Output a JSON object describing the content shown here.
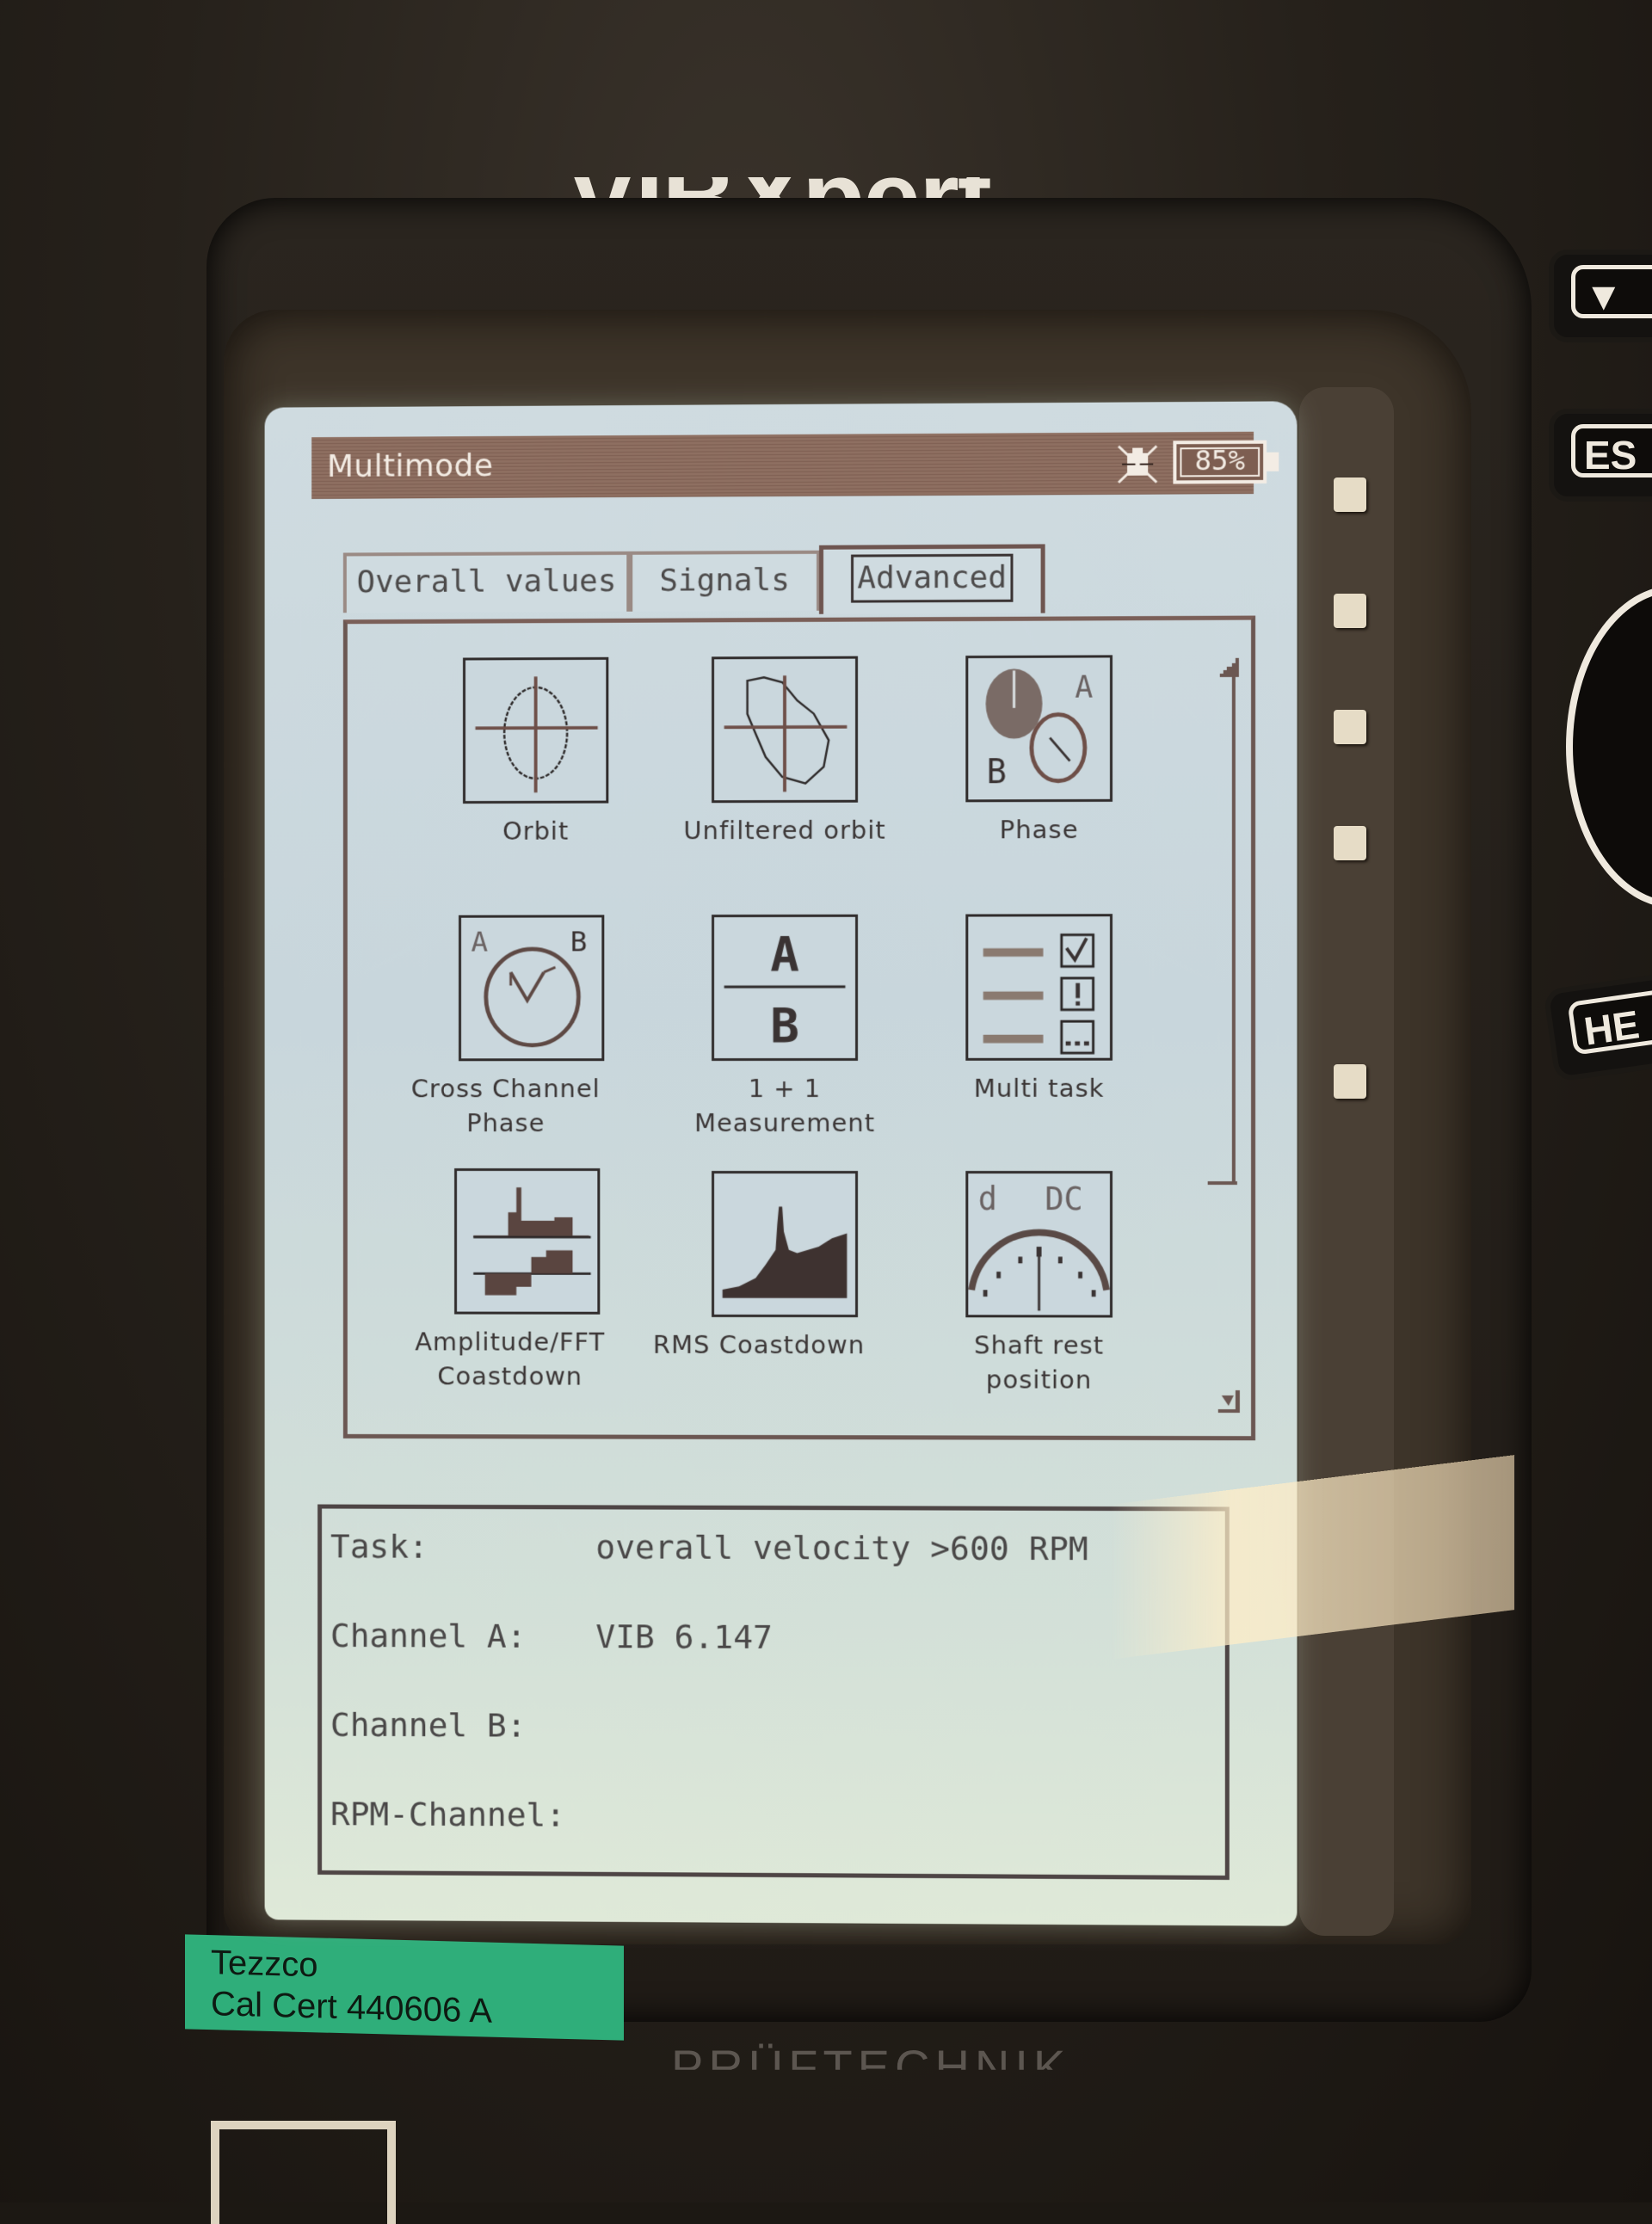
{
  "device": {
    "brand_top": "VIBXpert",
    "brand_bottom": "PRÜFTECHNIK",
    "asset_label": [
      "Tezzco",
      "Cal Cert 440606 A"
    ],
    "hardware_buttons": [
      {
        "name": "down-arrow-button",
        "label": "▼"
      },
      {
        "name": "esc-button",
        "label": "ES"
      },
      {
        "name": "help-button",
        "label": "HE"
      }
    ],
    "soft_key_count": 5
  },
  "titlebar": {
    "title": "Multimode",
    "sensor_icon": "sensor-disconnected-icon",
    "battery_percent": "85%"
  },
  "tabs": [
    {
      "label": "Overall values",
      "active": false
    },
    {
      "label": "Signals",
      "active": false
    },
    {
      "label": "Advanced",
      "active": true
    }
  ],
  "modes": [
    {
      "label": "Orbit",
      "icon": "orbit-icon"
    },
    {
      "label": "Unfiltered orbit",
      "icon": "unfiltered-orbit-icon"
    },
    {
      "label": "Phase",
      "icon": "phase-icon"
    },
    {
      "label": "Cross Channel\nPhase",
      "icon": "cross-channel-phase-icon"
    },
    {
      "label": "1 + 1\nMeasurement",
      "icon": "one-plus-one-measurement-icon"
    },
    {
      "label": "Multi task",
      "icon": "multi-task-icon"
    },
    {
      "label": "Amplitude/FFT\nCoastdown",
      "icon": "amplitude-fft-coastdown-icon"
    },
    {
      "label": "RMS Coastdown",
      "icon": "rms-coastdown-icon"
    },
    {
      "label": "Shaft rest\nposition",
      "icon": "shaft-rest-position-icon"
    }
  ],
  "icon_glyphs": {
    "phase_a": "A",
    "phase_b": "B",
    "ab_top": "A",
    "ab_bottom": "B",
    "ccp_a": "A",
    "ccp_b": "B",
    "shaft_d": "d",
    "shaft_dc": "DC"
  },
  "info": {
    "rows": [
      {
        "key": "Task:",
        "value": "overall velocity >600 RPM"
      },
      {
        "key": "Channel A:",
        "value": "VIB 6.147"
      },
      {
        "key": "Channel B:",
        "value": ""
      },
      {
        "key": "RPM-Channel:",
        "value": ""
      }
    ]
  },
  "colors": {
    "lcd_bg": "#cfdbe0",
    "titlebar": "#8e6f61",
    "lcd_ink": "#302c2c",
    "accent_brown": "#6b5752"
  }
}
